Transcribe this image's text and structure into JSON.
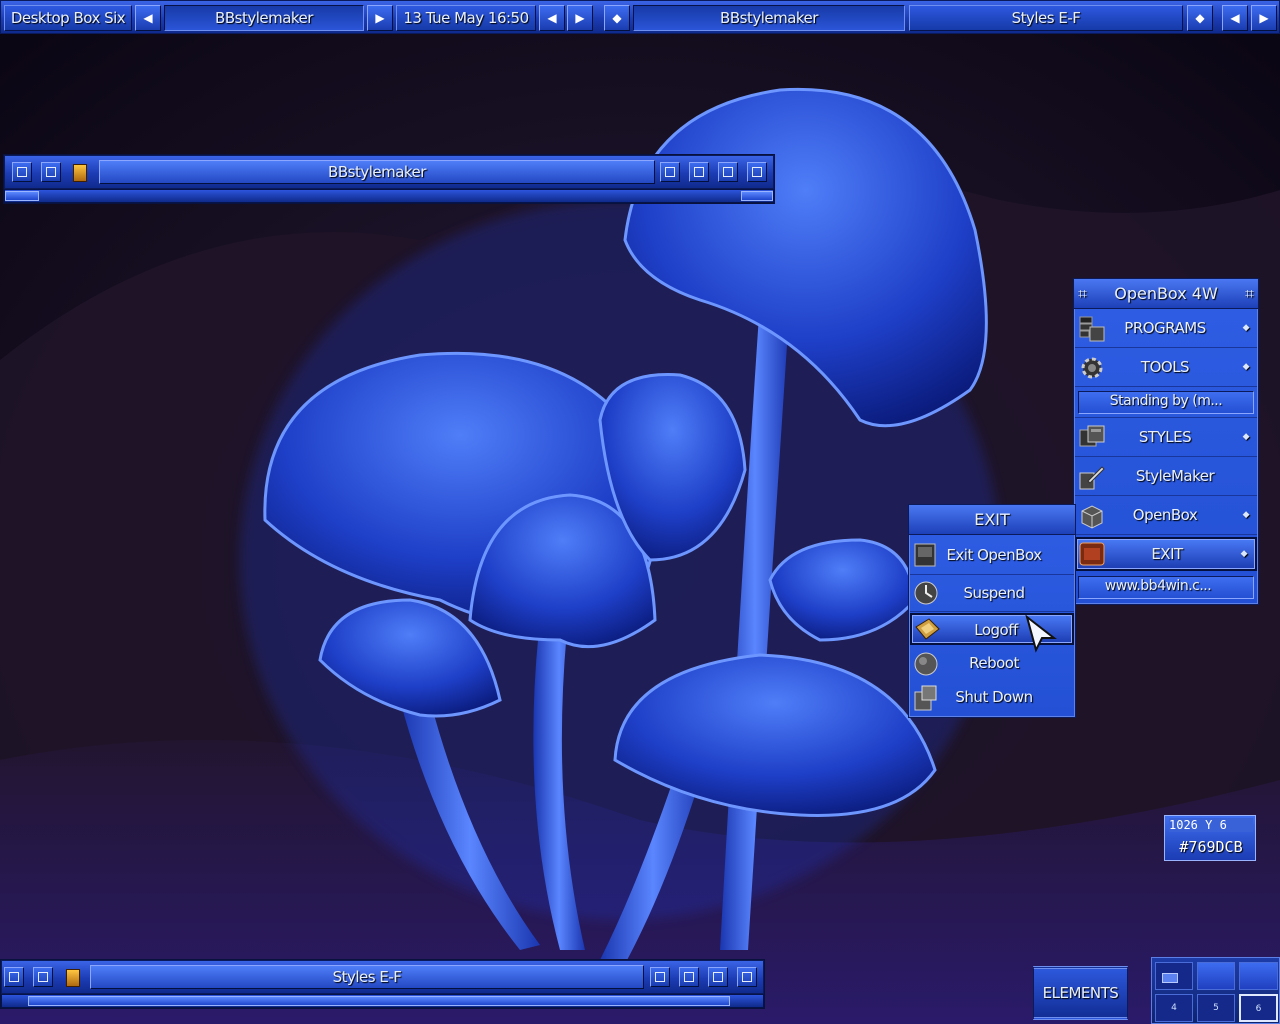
{
  "toolbar": {
    "workspace": "Desktop Box Six",
    "window_left": "BBstylemaker",
    "clock": "13 Tue May 16:50",
    "window_right": "BBstylemaker",
    "window_far": "Styles E-F"
  },
  "window_top": {
    "title": "BBstylemaker"
  },
  "window_bottom": {
    "title": "Styles E-F"
  },
  "main_menu": {
    "title": "OpenBox 4W",
    "items": [
      {
        "label": "PROGRAMS",
        "icon": "programs-icon",
        "submenu": true
      },
      {
        "label": "TOOLS",
        "icon": "gear-icon",
        "submenu": true
      },
      {
        "label": "Standing by (m...",
        "boxed": true
      },
      {
        "label": "STYLES",
        "icon": "styles-icon",
        "submenu": true
      },
      {
        "label": "StyleMaker",
        "icon": "stylemaker-icon"
      },
      {
        "label": "OpenBox",
        "icon": "box-icon",
        "submenu": true
      },
      {
        "label": "EXIT",
        "icon": "exit-icon",
        "submenu": true,
        "active": true
      },
      {
        "label": "www.bb4win.c...",
        "boxed": true
      }
    ]
  },
  "exit_menu": {
    "title": "EXIT",
    "items": [
      {
        "label": "Exit OpenBox",
        "icon": "exit-openbox-icon"
      },
      {
        "label": "Suspend",
        "icon": "suspend-icon"
      },
      {
        "label": "Logoff",
        "icon": "logoff-icon",
        "active": true
      },
      {
        "label": "Reboot",
        "icon": "reboot-icon"
      },
      {
        "label": "Shut Down",
        "icon": "shutdown-icon"
      }
    ]
  },
  "color_picker": {
    "coords": "1026 Y 6",
    "hex": "#769DCB"
  },
  "elements_button": "ELEMENTS",
  "pager": {
    "cells": [
      "4",
      "5",
      "6"
    ]
  },
  "colors": {
    "accent": "#2a54d8",
    "accent_light": "#4a7af6",
    "dark_border": "#0a1a5a",
    "background": "#0d0718"
  }
}
